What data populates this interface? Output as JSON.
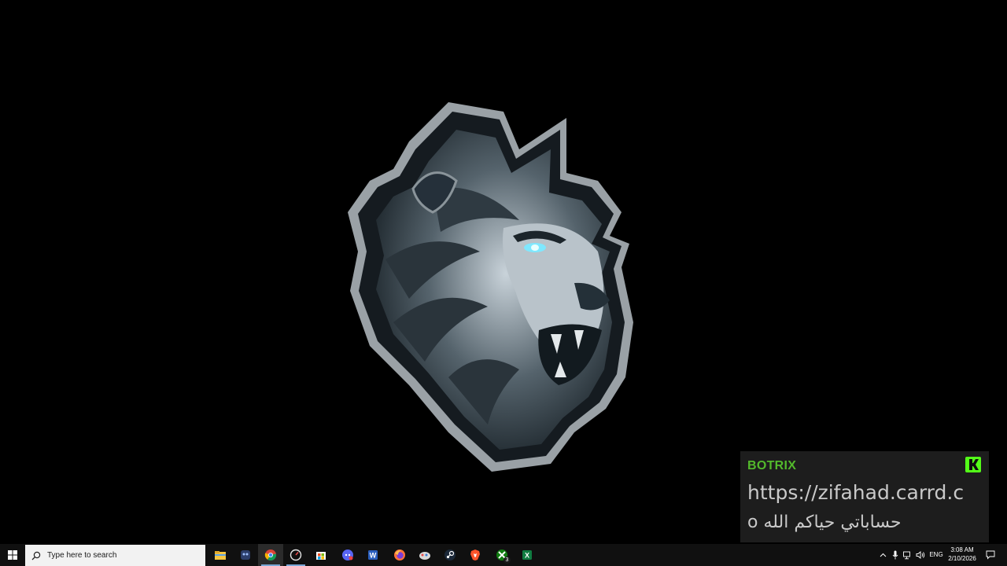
{
  "desktop": {
    "background_color": "#000000",
    "wallpaper_icon": "lion-head-logo-icon"
  },
  "botrix": {
    "name": "BOTRIX",
    "name_color": "#53b92c",
    "icon": "kick-icon",
    "message_line_1": "https://zifahad.carrd.c",
    "message_line_2": "o حساباتي حياكم الله"
  },
  "taskbar": {
    "start_icon": "windows-start-icon",
    "search": {
      "placeholder": "Type here to search",
      "icon": "search-icon"
    },
    "apps": [
      {
        "name": "file-explorer-icon"
      },
      {
        "name": "app-icon"
      },
      {
        "name": "chrome-icon"
      },
      {
        "name": "speed-icon"
      },
      {
        "name": "store-icon"
      },
      {
        "name": "discord-icon"
      },
      {
        "name": "word-icon"
      },
      {
        "name": "firefox-icon"
      },
      {
        "name": "app-icon"
      },
      {
        "name": "steam-icon"
      },
      {
        "name": "brave-icon"
      },
      {
        "name": "xbox-icon",
        "badge": "3"
      },
      {
        "name": "excel-icon"
      }
    ],
    "tray": {
      "show_hidden_icon": "chevron-up-icon",
      "mic_icon": "microphone-icon",
      "network_icon": "network-icon",
      "volume_icon": "volume-icon",
      "language": "ENG",
      "time": "3:08 AM",
      "date": "2/10/2026",
      "notifications_icon": "notifications-icon"
    }
  }
}
